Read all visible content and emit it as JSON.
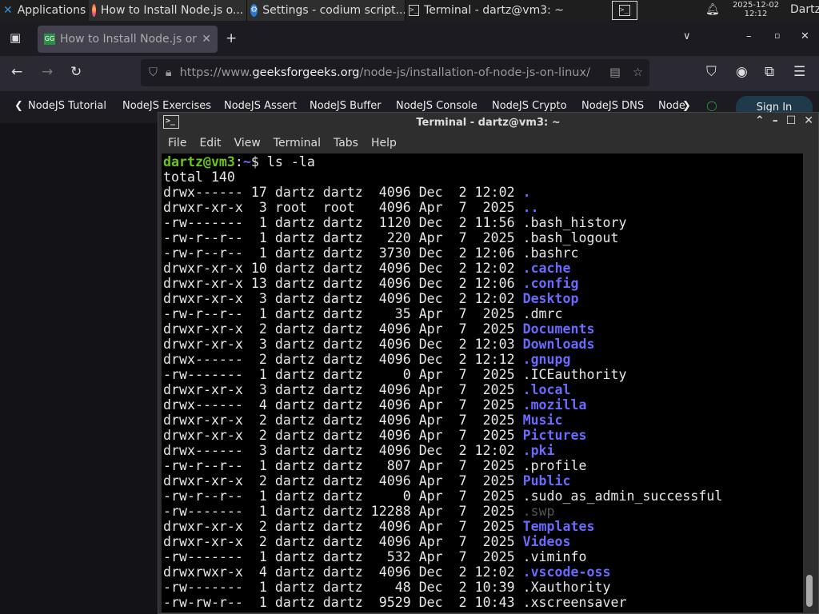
{
  "taskbar": {
    "apps": "Applications",
    "windows": [
      "How to Install Node.js o...",
      "Settings - codium script...",
      "Terminal - dartz@vm3: ~"
    ],
    "date": "2025-12-02",
    "time": "12:12",
    "user": "Dartz"
  },
  "browser": {
    "tab_title": "How to Install Node.js on",
    "url_prefix": "https://www.",
    "url_domain": "geeksforgeeks.org",
    "url_path": "/node-js/installation-of-node-js-on-linux/",
    "bookmarks": [
      "NodeJS Tutorial",
      "NodeJS Exercises",
      "NodeJS Assert",
      "NodeJS Buffer",
      "NodeJS Console",
      "NodeJS Crypto",
      "NodeJS DNS",
      "Node"
    ],
    "sign_in": "Sign In"
  },
  "terminal": {
    "title": "Terminal - dartz@vm3: ~",
    "menu": [
      "File",
      "Edit",
      "View",
      "Terminal",
      "Tabs",
      "Help"
    ],
    "prompt_user": "dartz@vm3",
    "prompt_path": "~",
    "prompt_end": "$ ",
    "command": "ls -la",
    "total": "total 140",
    "entries": [
      {
        "meta": "drwx------ 17 dartz dartz  4096 Dec  2 12:02 ",
        "name": ".",
        "kind": "dir"
      },
      {
        "meta": "drwxr-xr-x  3 root  root   4096 Apr  7  2025 ",
        "name": "..",
        "kind": "dir"
      },
      {
        "meta": "-rw-------  1 dartz dartz  1120 Dec  2 11:56 ",
        "name": ".bash_history",
        "kind": "file"
      },
      {
        "meta": "-rw-r--r--  1 dartz dartz   220 Apr  7  2025 ",
        "name": ".bash_logout",
        "kind": "file"
      },
      {
        "meta": "-rw-r--r--  1 dartz dartz  3730 Dec  2 12:06 ",
        "name": ".bashrc",
        "kind": "file"
      },
      {
        "meta": "drwxr-xr-x 10 dartz dartz  4096 Dec  2 12:02 ",
        "name": ".cache",
        "kind": "dir"
      },
      {
        "meta": "drwxr-xr-x 13 dartz dartz  4096 Dec  2 12:06 ",
        "name": ".config",
        "kind": "dir"
      },
      {
        "meta": "drwxr-xr-x  3 dartz dartz  4096 Dec  2 12:02 ",
        "name": "Desktop",
        "kind": "dir"
      },
      {
        "meta": "-rw-r--r--  1 dartz dartz    35 Apr  7  2025 ",
        "name": ".dmrc",
        "kind": "file"
      },
      {
        "meta": "drwxr-xr-x  2 dartz dartz  4096 Apr  7  2025 ",
        "name": "Documents",
        "kind": "dir"
      },
      {
        "meta": "drwxr-xr-x  3 dartz dartz  4096 Dec  2 12:03 ",
        "name": "Downloads",
        "kind": "dir"
      },
      {
        "meta": "drwx------  2 dartz dartz  4096 Dec  2 12:12 ",
        "name": ".gnupg",
        "kind": "dir"
      },
      {
        "meta": "-rw-------  1 dartz dartz     0 Apr  7  2025 ",
        "name": ".ICEauthority",
        "kind": "file"
      },
      {
        "meta": "drwxr-xr-x  3 dartz dartz  4096 Apr  7  2025 ",
        "name": ".local",
        "kind": "dir"
      },
      {
        "meta": "drwx------  4 dartz dartz  4096 Apr  7  2025 ",
        "name": ".mozilla",
        "kind": "dir"
      },
      {
        "meta": "drwxr-xr-x  2 dartz dartz  4096 Apr  7  2025 ",
        "name": "Music",
        "kind": "dir"
      },
      {
        "meta": "drwxr-xr-x  2 dartz dartz  4096 Apr  7  2025 ",
        "name": "Pictures",
        "kind": "dir"
      },
      {
        "meta": "drwx------  3 dartz dartz  4096 Dec  2 12:02 ",
        "name": ".pki",
        "kind": "dir"
      },
      {
        "meta": "-rw-r--r--  1 dartz dartz   807 Apr  7  2025 ",
        "name": ".profile",
        "kind": "file"
      },
      {
        "meta": "drwxr-xr-x  2 dartz dartz  4096 Apr  7  2025 ",
        "name": "Public",
        "kind": "dir"
      },
      {
        "meta": "-rw-r--r--  1 dartz dartz     0 Apr  7  2025 ",
        "name": ".sudo_as_admin_successful",
        "kind": "file"
      },
      {
        "meta": "-rw-------  1 dartz dartz 12288 Apr  7  2025 ",
        "name": ".swp",
        "kind": "dim"
      },
      {
        "meta": "drwxr-xr-x  2 dartz dartz  4096 Apr  7  2025 ",
        "name": "Templates",
        "kind": "dir"
      },
      {
        "meta": "drwxr-xr-x  2 dartz dartz  4096 Apr  7  2025 ",
        "name": "Videos",
        "kind": "dir"
      },
      {
        "meta": "-rw-------  1 dartz dartz   532 Apr  7  2025 ",
        "name": ".viminfo",
        "kind": "file"
      },
      {
        "meta": "drwxrwxr-x  4 dartz dartz  4096 Dec  2 12:02 ",
        "name": ".vscode-oss",
        "kind": "dir"
      },
      {
        "meta": "-rw-------  1 dartz dartz    48 Dec  2 10:39 ",
        "name": ".Xauthority",
        "kind": "file"
      },
      {
        "meta": "-rw-rw-r--  1 dartz dartz  9529 Dec  2 10:43 ",
        "name": ".xscreensaver",
        "kind": "file"
      }
    ]
  },
  "colors": {
    "prompt_user": "#6ac520",
    "directory": "#6a6aff",
    "terminal_bg": "#000000"
  }
}
